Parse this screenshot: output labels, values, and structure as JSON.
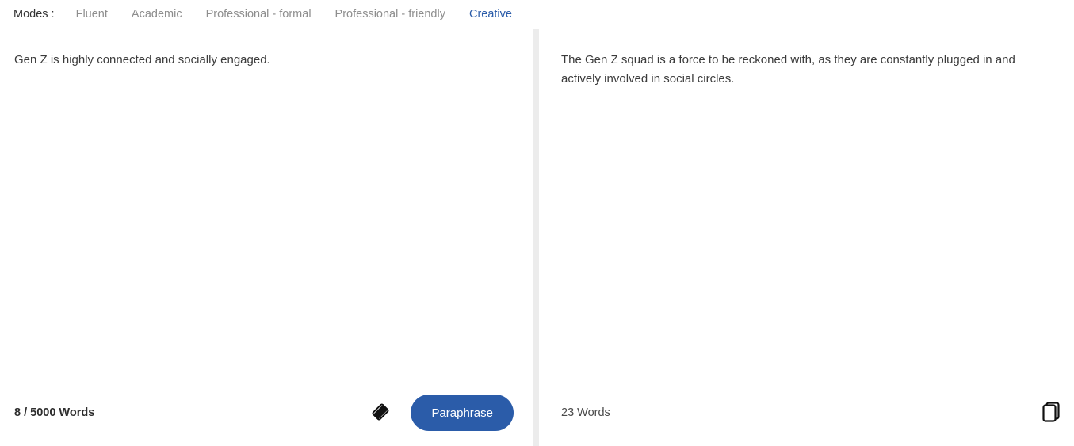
{
  "header": {
    "modes_label": "Modes :",
    "tabs": [
      {
        "label": "Fluent",
        "active": false
      },
      {
        "label": "Academic",
        "active": false
      },
      {
        "label": "Professional - formal",
        "active": false
      },
      {
        "label": "Professional - friendly",
        "active": false
      },
      {
        "label": "Creative",
        "active": true
      }
    ]
  },
  "input_panel": {
    "text": "Gen Z is highly connected and socially engaged.",
    "word_count": "8 / 5000 Words",
    "clear_icon": "eraser-icon",
    "action_label": "Paraphrase"
  },
  "output_panel": {
    "text": "The Gen Z squad is a force to be reckoned with, as they are constantly plugged in and actively involved in social circles.",
    "word_count": "23 Words",
    "copy_icon": "copy-icon"
  },
  "colors": {
    "accent": "#2b5ca9",
    "inactive_tab": "#8e8e8e",
    "body_text": "#3b3b3b",
    "divider": "#ececec"
  }
}
